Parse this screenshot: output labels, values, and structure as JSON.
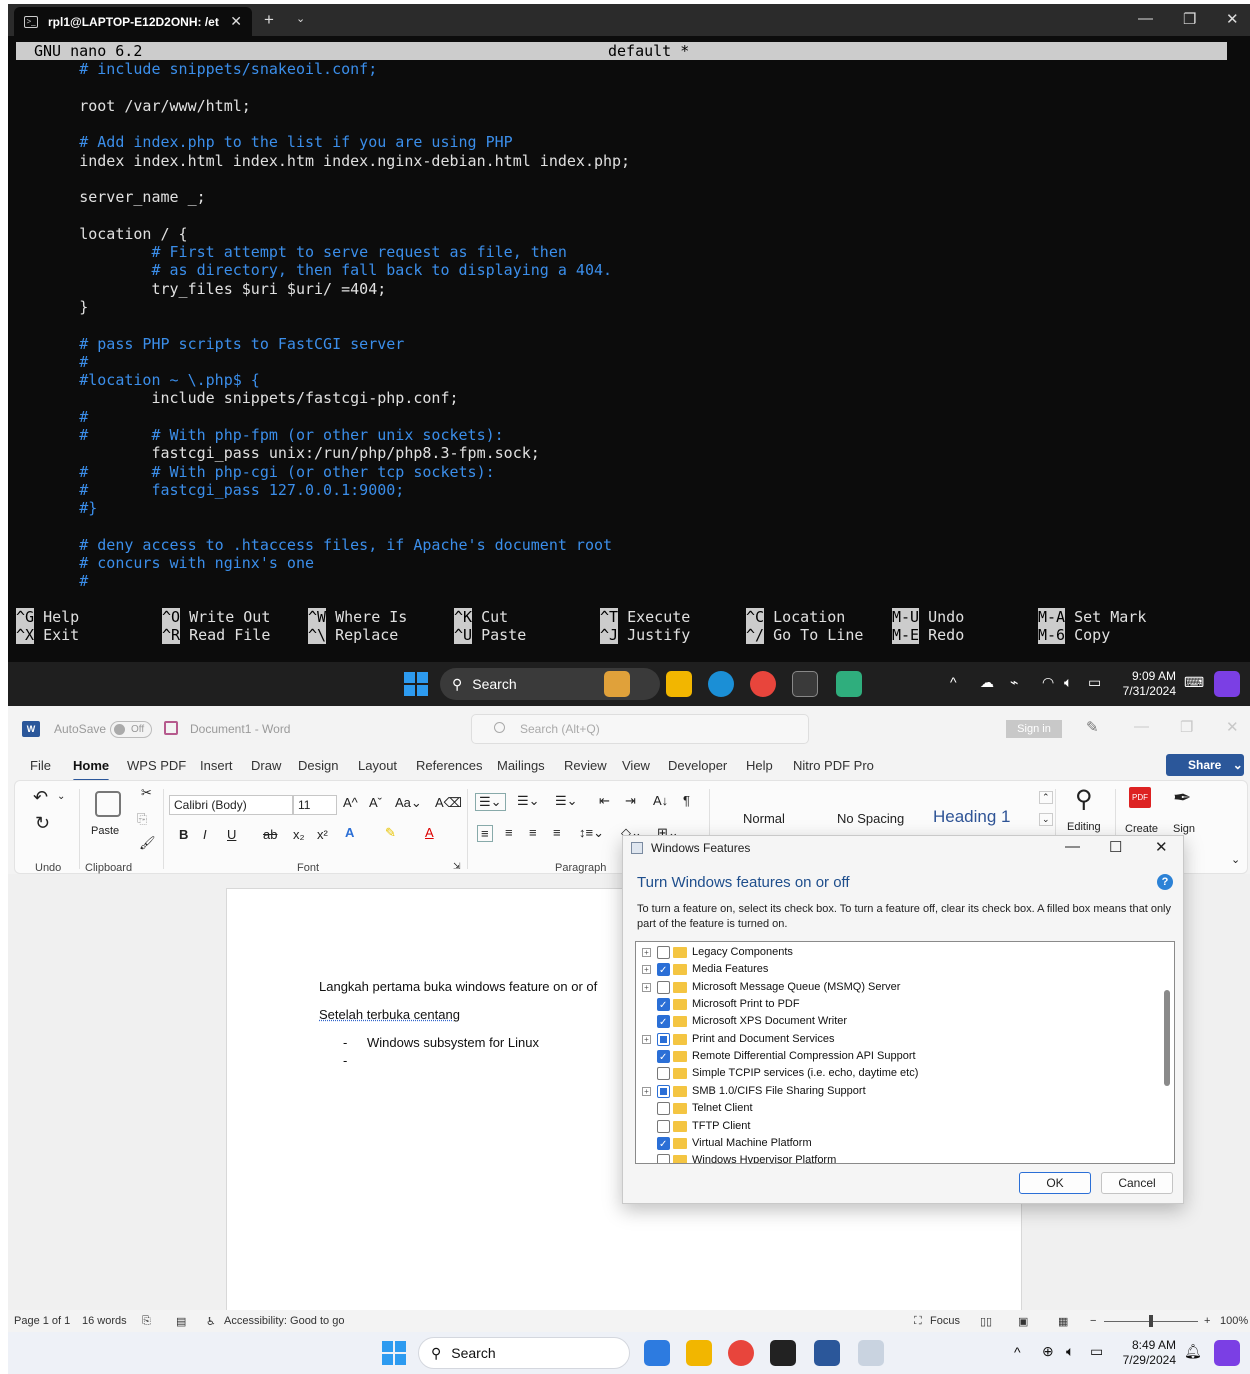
{
  "terminal": {
    "tab_title": "rpl1@LAPTOP-E12D2ONH: /et",
    "nano_version": "GNU nano 6.2",
    "file_name": "default *",
    "lines": [
      {
        "text": "       # include snippets/snakeoil.conf;",
        "comment": true
      },
      {
        "text": "",
        "comment": false
      },
      {
        "text": "       root /var/www/html;",
        "comment": false
      },
      {
        "text": "",
        "comment": false
      },
      {
        "text": "       # Add index.php to the list if you are using PHP",
        "comment": true
      },
      {
        "text": "       index index.html index.htm index.nginx-debian.html index.php;",
        "comment": false
      },
      {
        "text": "",
        "comment": false
      },
      {
        "text": "       server_name _;",
        "comment": false
      },
      {
        "text": "",
        "comment": false
      },
      {
        "text": "       location / {",
        "comment": false
      },
      {
        "text": "               # First attempt to serve request as file, then",
        "comment": true
      },
      {
        "text": "               # as directory, then fall back to displaying a 404.",
        "comment": true
      },
      {
        "text": "               try_files $uri $uri/ =404;",
        "comment": false
      },
      {
        "text": "       }",
        "comment": false
      },
      {
        "text": "",
        "comment": false
      },
      {
        "text": "       # pass PHP scripts to FastCGI server",
        "comment": true
      },
      {
        "text": "       #",
        "comment": true
      },
      {
        "text": "       #location ~ \\.php$ {",
        "comment": true
      },
      {
        "text": "               include snippets/fastcgi-php.conf;",
        "comment": false
      },
      {
        "text": "       #",
        "comment": true
      },
      {
        "text": "       #       # With php-fpm (or other unix sockets):",
        "comment": true
      },
      {
        "text": "               fastcgi_pass unix:/run/php/php8.3-fpm.sock;",
        "comment": false
      },
      {
        "text": "       #       # With php-cgi (or other tcp sockets):",
        "comment": true
      },
      {
        "text": "       #       fastcgi_pass 127.0.0.1:9000;",
        "comment": true
      },
      {
        "text": "       #}",
        "comment": true
      },
      {
        "text": "",
        "comment": false
      },
      {
        "text": "       # deny access to .htaccess files, if Apache's document root",
        "comment": true
      },
      {
        "text": "       # concurs with nginx's one",
        "comment": true
      },
      {
        "text": "       #",
        "comment": true
      }
    ],
    "shortcuts": [
      [
        {
          "key": "^G",
          "label": "Help"
        },
        {
          "key": "^X",
          "label": "Exit"
        }
      ],
      [
        {
          "key": "^O",
          "label": "Write Out"
        },
        {
          "key": "^R",
          "label": "Read File"
        }
      ],
      [
        {
          "key": "^W",
          "label": "Where Is"
        },
        {
          "key": "^\\",
          "label": "Replace"
        }
      ],
      [
        {
          "key": "^K",
          "label": "Cut"
        },
        {
          "key": "^U",
          "label": "Paste"
        }
      ],
      [
        {
          "key": "^T",
          "label": "Execute"
        },
        {
          "key": "^J",
          "label": "Justify"
        }
      ],
      [
        {
          "key": "^C",
          "label": "Location"
        },
        {
          "key": "^/",
          "label": "Go To Line"
        }
      ],
      [
        {
          "key": "M-U",
          "label": "Undo"
        },
        {
          "key": "M-E",
          "label": "Redo"
        }
      ],
      [
        {
          "key": "M-A",
          "label": "Set Mark"
        },
        {
          "key": "M-6",
          "label": "Copy"
        }
      ]
    ]
  },
  "taskbar1": {
    "search": "Search",
    "time": "9:09 AM",
    "date": "7/31/2024"
  },
  "word": {
    "autosave": "AutoSave",
    "autosave_state": "Off",
    "doc_title": "Document1  -  Word",
    "search_placeholder": "Search (Alt+Q)",
    "sign_in": "Sign in",
    "share": "Share",
    "tabs": [
      "File",
      "Home",
      "WPS PDF",
      "Insert",
      "Draw",
      "Design",
      "Layout",
      "References",
      "Mailings",
      "Review",
      "View",
      "Developer",
      "Help",
      "Nitro PDF Pro"
    ],
    "font_name": "Calibri (Body)",
    "font_size": "11",
    "groups": {
      "undo": "Undo",
      "clipboard": "Clipboard",
      "font": "Font",
      "paragraph": "Paragraph"
    },
    "paste": "Paste",
    "styles": [
      "Normal",
      "No Spacing",
      "Heading 1"
    ],
    "editing": "Editing",
    "create": "Create",
    "sign": "Sign",
    "doc": {
      "line1": "Langkah pertama buka windows feature on or of",
      "line2": "Setelah terbuka centang",
      "bullet1": "Windows subsystem for Linux",
      "bullet2": ""
    },
    "status": {
      "page": "Page 1 of 1",
      "words": "16 words",
      "accessibility": "Accessibility: Good to go",
      "focus": "Focus",
      "zoom": "100%"
    }
  },
  "dialog": {
    "title": "Windows Features",
    "heading": "Turn Windows features on or off",
    "description": "To turn a feature on, select its check box. To turn a feature off, clear its check box. A filled box means that only part of the feature is turned on.",
    "features": [
      {
        "name": "Legacy Components",
        "state": "unchecked",
        "expandable": true
      },
      {
        "name": "Media Features",
        "state": "checked",
        "expandable": true
      },
      {
        "name": "Microsoft Message Queue (MSMQ) Server",
        "state": "unchecked",
        "expandable": true
      },
      {
        "name": "Microsoft Print to PDF",
        "state": "checked",
        "expandable": false
      },
      {
        "name": "Microsoft XPS Document Writer",
        "state": "checked",
        "expandable": false
      },
      {
        "name": "Print and Document Services",
        "state": "partial",
        "expandable": true
      },
      {
        "name": "Remote Differential Compression API Support",
        "state": "checked",
        "expandable": false
      },
      {
        "name": "Simple TCPIP services (i.e. echo, daytime etc)",
        "state": "unchecked",
        "expandable": false
      },
      {
        "name": "SMB 1.0/CIFS File Sharing Support",
        "state": "partial",
        "expandable": true
      },
      {
        "name": "Telnet Client",
        "state": "unchecked",
        "expandable": false
      },
      {
        "name": "TFTP Client",
        "state": "unchecked",
        "expandable": false
      },
      {
        "name": "Virtual Machine Platform",
        "state": "checked",
        "expandable": false
      },
      {
        "name": "Windows Hypervisor Platform",
        "state": "unchecked",
        "expandable": false
      }
    ],
    "ok": "OK",
    "cancel": "Cancel"
  },
  "taskbar2": {
    "search": "Search",
    "time": "8:49 AM",
    "date": "7/29/2024"
  }
}
